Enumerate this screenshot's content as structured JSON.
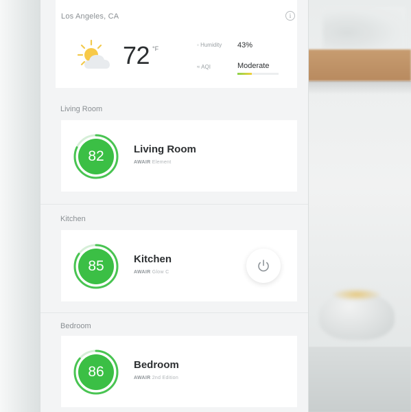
{
  "weather": {
    "location": "Los Angeles, CA",
    "info_icon": "info-icon",
    "condition_icon": "partly-sunny-icon",
    "temperature": "72",
    "temperature_unit": "°F",
    "humidity_label": "Humidity",
    "humidity_value": "43%",
    "aqi_label": "AQI",
    "aqi_value": "Moderate",
    "aqi_level": 0.35
  },
  "sections": [
    {
      "label": "Living Room",
      "room": {
        "name": "Living Room",
        "score": "82",
        "device_brand": "AWAIR",
        "device_model": "Element",
        "progress": 0.82
      }
    },
    {
      "label": "Kitchen",
      "room": {
        "name": "Kitchen",
        "score": "85",
        "device_brand": "AWAIR",
        "device_model": "Glow C",
        "progress": 0.85,
        "action_icon": "power-icon"
      }
    },
    {
      "label": "Bedroom",
      "room": {
        "name": "Bedroom",
        "score": "86",
        "device_brand": "AWAIR",
        "device_model": "2nd Edition",
        "progress": 0.86
      }
    }
  ],
  "colors": {
    "score_green": "#3bbf45",
    "ring_track": "#d6efd8",
    "ring_progress": "#49c452"
  }
}
